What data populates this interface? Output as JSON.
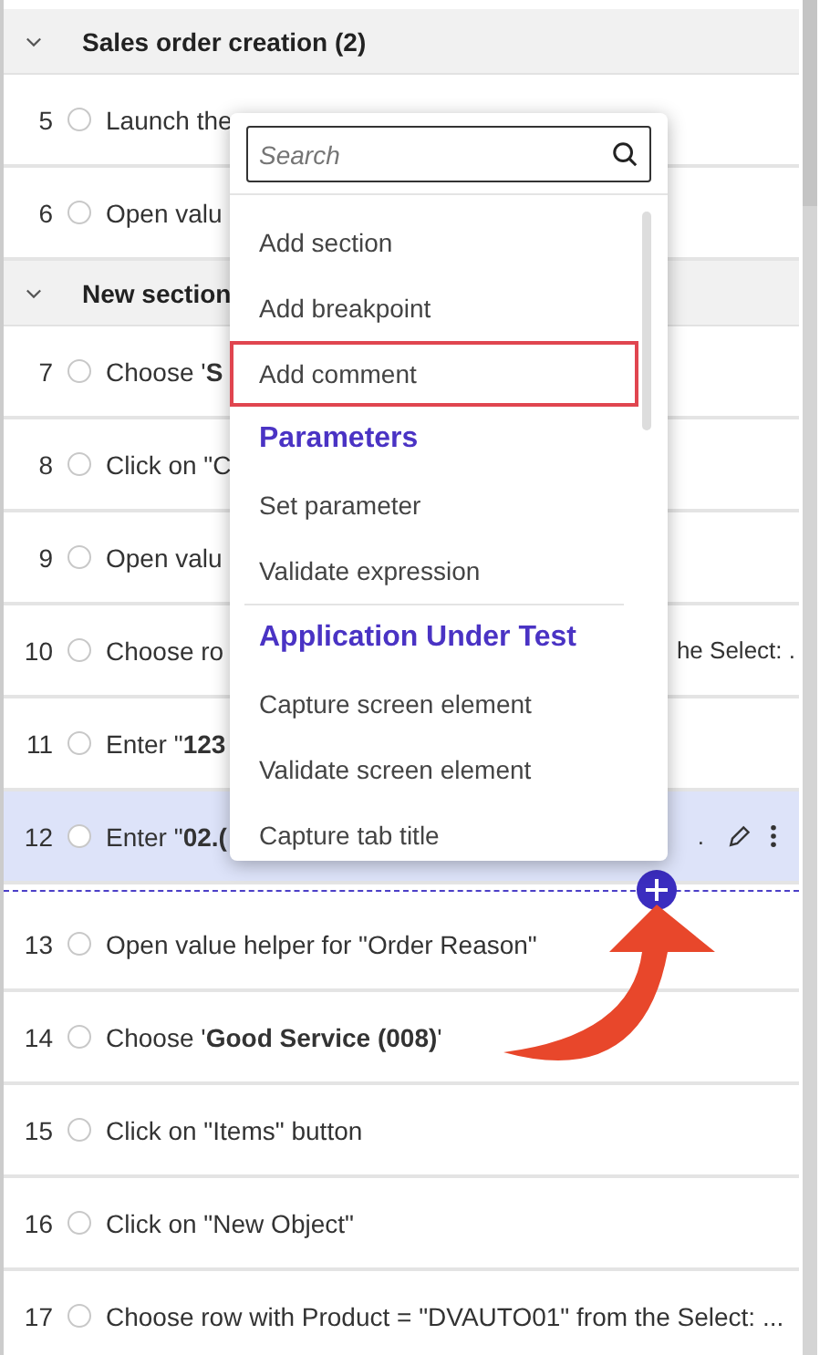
{
  "list": [
    {
      "kind": "section",
      "title": "Sales order creation (2)",
      "expanded": true
    },
    {
      "kind": "step",
      "number": "5",
      "text": "Launch the",
      "selected": false
    },
    {
      "kind": "step",
      "number": "6",
      "text": "Open valu",
      "selected": false
    },
    {
      "kind": "section",
      "title": "New section",
      "expanded": true
    },
    {
      "kind": "step",
      "number": "7",
      "text": "Choose '**S**",
      "selected": false
    },
    {
      "kind": "step",
      "number": "8",
      "text": "Click on \"C",
      "selected": false
    },
    {
      "kind": "step",
      "number": "9",
      "text": "Open valu",
      "selected": false
    },
    {
      "kind": "step",
      "number": "10",
      "text": "Choose ro",
      "tail": "he Select: .",
      "selected": false
    },
    {
      "kind": "step",
      "number": "11",
      "text": "Enter \"**123**",
      "selected": false
    },
    {
      "kind": "step",
      "number": "12",
      "text": "Enter \"**02.(**",
      "tail": ".",
      "selected": true
    },
    {
      "kind": "insert"
    },
    {
      "kind": "step",
      "number": "13",
      "text": "Open value helper for \"Order Reason\"",
      "selected": false
    },
    {
      "kind": "step",
      "number": "14",
      "text": "Choose '**Good Service (008)**'",
      "selected": false
    },
    {
      "kind": "step",
      "number": "15",
      "text": "Click on \"Items\" button",
      "selected": false
    },
    {
      "kind": "step",
      "number": "16",
      "text": "Click on \"New Object\"",
      "selected": false
    },
    {
      "kind": "step",
      "number": "17",
      "text": "Choose row with Product = \"DVAUTO01\" from the Select: ...",
      "selected": false
    }
  ],
  "menu": {
    "search": {
      "placeholder": "Search"
    },
    "items": [
      {
        "kind": "item",
        "label": "Add section",
        "highlighted": false
      },
      {
        "kind": "item",
        "label": "Add breakpoint",
        "highlighted": false
      },
      {
        "kind": "item",
        "label": "Add comment",
        "highlighted": true
      },
      {
        "kind": "heading",
        "label": "Parameters"
      },
      {
        "kind": "item",
        "label": "Set parameter",
        "highlighted": false
      },
      {
        "kind": "item",
        "label": "Validate expression",
        "highlighted": false
      },
      {
        "kind": "divider"
      },
      {
        "kind": "heading",
        "label": "Application Under Test"
      },
      {
        "kind": "item",
        "label": "Capture screen element",
        "highlighted": false
      },
      {
        "kind": "item",
        "label": "Validate screen element",
        "highlighted": false
      },
      {
        "kind": "item",
        "label": "Capture tab title",
        "highlighted": false
      }
    ]
  }
}
